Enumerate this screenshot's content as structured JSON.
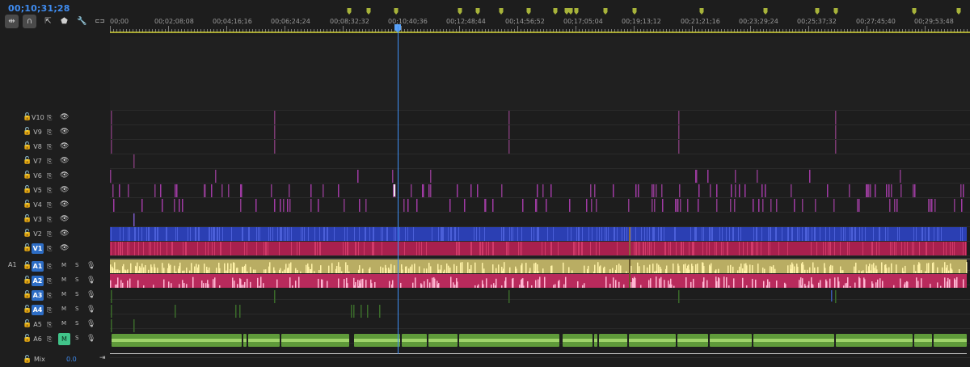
{
  "header": {
    "timecode": "00;10;31;28",
    "tools": [
      {
        "name": "snap-icon",
        "glyph": "⇹"
      },
      {
        "name": "linked-selection-icon",
        "glyph": "∩"
      },
      {
        "name": "add-marker-icon",
        "glyph": "⇱"
      },
      {
        "name": "marker-icon",
        "glyph": "⬟"
      },
      {
        "name": "wrench-icon",
        "glyph": "🔧"
      },
      {
        "name": "captions-icon",
        "glyph": "⊏⊐"
      }
    ]
  },
  "ruler": {
    "timecodes": [
      "00;00",
      "00;02;08;08",
      "00;04;16;16",
      "00;06;24;24",
      "00;08;32;32",
      "00;10;40;36",
      "00;12;48;44",
      "00;14;56;52",
      "00;17;05;04",
      "00;19;13;12",
      "00;21;21;16",
      "00;23;29;24",
      "00;25;37;32",
      "00;27;45;40",
      "00;29;53;48"
    ]
  },
  "video_tracks": [
    {
      "label": "V10",
      "targeted": false
    },
    {
      "label": "V9",
      "targeted": false
    },
    {
      "label": "V8",
      "targeted": false
    },
    {
      "label": "V7",
      "targeted": false
    },
    {
      "label": "V6",
      "targeted": false
    },
    {
      "label": "V5",
      "targeted": false
    },
    {
      "label": "V4",
      "targeted": false
    },
    {
      "label": "V3",
      "targeted": false
    },
    {
      "label": "V2",
      "targeted": false
    },
    {
      "label": "V1",
      "targeted": true
    }
  ],
  "audio_tracks": [
    {
      "source": "A1",
      "label": "A1",
      "targeted": true,
      "m": "M",
      "s": "S",
      "m_active": false
    },
    {
      "source": "",
      "label": "A2",
      "targeted": true,
      "m": "M",
      "s": "S",
      "m_active": false
    },
    {
      "source": "",
      "label": "A3",
      "targeted": true,
      "m": "M",
      "s": "S",
      "m_active": false
    },
    {
      "source": "",
      "label": "A4",
      "targeted": true,
      "m": "M",
      "s": "S",
      "m_active": false
    },
    {
      "source": "",
      "label": "A5",
      "targeted": false,
      "m": "M",
      "s": "S",
      "m_active": false
    },
    {
      "source": "",
      "label": "A6",
      "targeted": false,
      "m": "M",
      "s": "S",
      "m_active": true
    }
  ],
  "mix": {
    "label": "Mix",
    "value": "0.0"
  },
  "colors": {
    "playhead": "#3e8ff5",
    "v2_clip": "#2b3fb3",
    "v1_clip": "#a8204e",
    "a1_clip": "#b9ad63",
    "a2_clip": "#b82a5c",
    "a6_clip": "#5f9a3a",
    "marker": "#a8b43a"
  }
}
